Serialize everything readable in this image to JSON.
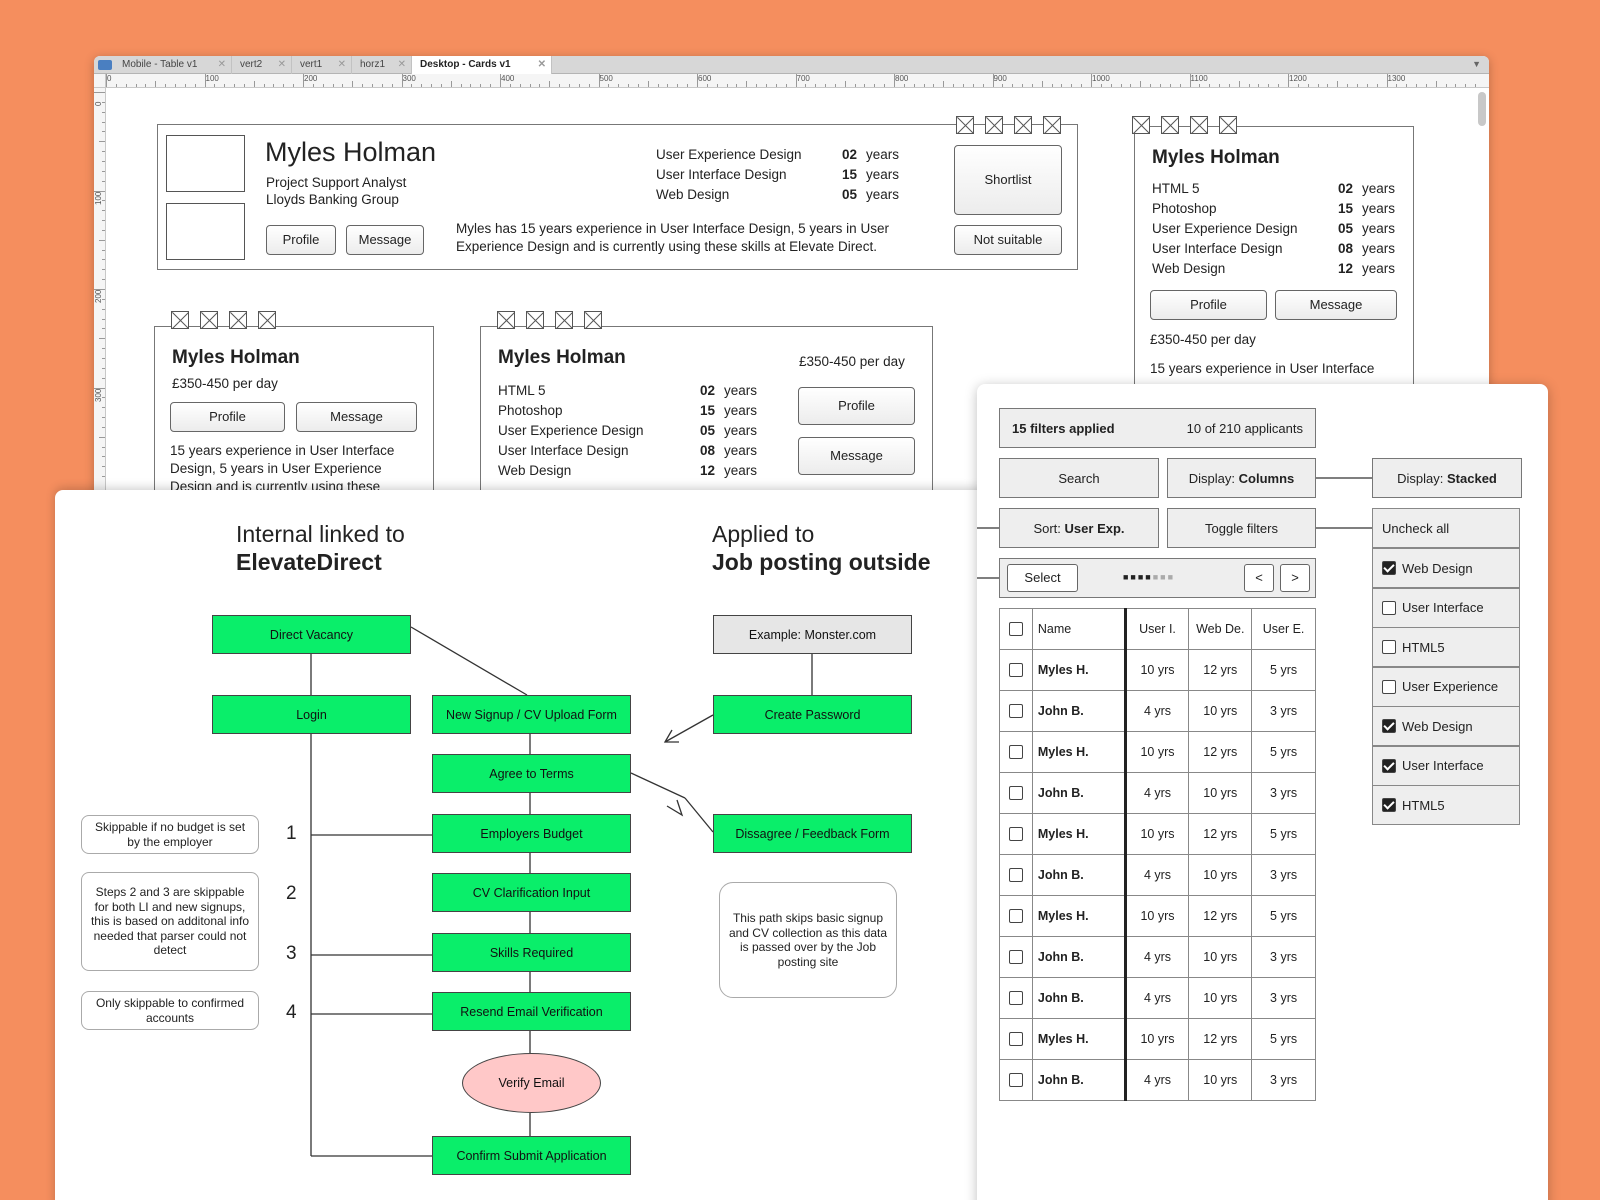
{
  "editor": {
    "tabs": [
      {
        "label": "Mobile - Table v1"
      },
      {
        "label": "vert2"
      },
      {
        "label": "vert1"
      },
      {
        "label": "horz1"
      },
      {
        "label": "Desktop - Cards v1",
        "active": true
      }
    ],
    "ruler_top": [
      "0",
      "100",
      "200",
      "300",
      "400",
      "500",
      "600",
      "700",
      "800",
      "900",
      "1000",
      "1100",
      "1200",
      "1300"
    ],
    "ruler_left": [
      "0",
      "100",
      "200",
      "300"
    ]
  },
  "card_wide": {
    "name": "Myles Holman",
    "role": "Project Support Analyst",
    "company": "Lloyds Banking Group",
    "profile_label": "Profile",
    "message_label": "Message",
    "skills": [
      {
        "skill": "User Experience Design",
        "num": "02",
        "unit": "years"
      },
      {
        "skill": "User Interface Design",
        "num": "15",
        "unit": "years"
      },
      {
        "skill": "Web Design",
        "num": "05",
        "unit": "years"
      }
    ],
    "summary": "Myles has 15 years experience in User Interface Design, 5 years in User Experience Design and is currently using these skills at Elevate Direct.",
    "shortlist_label": "Shortlist",
    "not_suitable_label": "Not suitable"
  },
  "card_right": {
    "name": "Myles Holman",
    "skills": [
      {
        "skill": "HTML 5",
        "num": "02",
        "unit": "years"
      },
      {
        "skill": "Photoshop",
        "num": "15",
        "unit": "years"
      },
      {
        "skill": "User Experience Design",
        "num": "05",
        "unit": "years"
      },
      {
        "skill": "User Interface Design",
        "num": "08",
        "unit": "years"
      },
      {
        "skill": "Web Design",
        "num": "12",
        "unit": "years"
      }
    ],
    "profile_label": "Profile",
    "message_label": "Message",
    "rate": "£350-450 per day",
    "summary": "15 years experience in User Interface"
  },
  "card_small": {
    "name": "Myles Holman",
    "rate": "£350-450 per day",
    "profile_label": "Profile",
    "message_label": "Message",
    "summary": "15 years experience in User Interface Design, 5 years in User Experience Design and is currently using these"
  },
  "card_mid": {
    "name": "Myles Holman",
    "rate": "£350-450 per day",
    "skills": [
      {
        "skill": "HTML 5",
        "num": "02",
        "unit": "years"
      },
      {
        "skill": "Photoshop",
        "num": "15",
        "unit": "years"
      },
      {
        "skill": "User Experience Design",
        "num": "05",
        "unit": "years"
      },
      {
        "skill": "User Interface Design",
        "num": "08",
        "unit": "years"
      },
      {
        "skill": "Web Design",
        "num": "12",
        "unit": "years"
      }
    ],
    "profile_label": "Profile",
    "message_label": "Message"
  },
  "flow": {
    "left_heading_1": "Internal linked to",
    "left_heading_2": "ElevateDirect",
    "right_heading_1": "Applied to",
    "right_heading_2": "Job posting outside",
    "direct_vacancy": "Direct Vacancy",
    "login": "Login",
    "new_signup": "New Signup / CV Upload Form",
    "agree_terms": "Agree to Terms",
    "employers_budget": "Employers Budget",
    "cv_clarification": "CV Clarification Input",
    "skills_required": "Skills Required",
    "resend_email": "Resend Email Verification",
    "verify_email": "Verify Email",
    "confirm_submit": "Confirm Submit Application",
    "example_monster": "Example: Monster.com",
    "create_password": "Create Password",
    "disagree_form": "Dissagree / Feedback Form",
    "note_1": "Skippable if no budget is set by the employer",
    "note_2": "Steps 2 and 3 are skippable for both LI and new signups, this is based on additonal info needed that parser could not detect",
    "note_3": "Only skippable to confirmed accounts",
    "note_right": "This path skips basic signup and CV collection as this data is passed over by the Job posting site",
    "steps": [
      "1",
      "2",
      "3",
      "4"
    ],
    "colors": {
      "green": "#0aee6a",
      "pink": "#ffc8c8",
      "grey": "#e6e6e6"
    }
  },
  "table_view": {
    "filters_applied": "15 filters applied",
    "applicants": "10 of 210 applicants",
    "search_label": "Search",
    "display_prefix": "Display:",
    "display_value": "Columns",
    "sort_prefix": "Sort:",
    "sort_value": "User Exp.",
    "toggle_filters": "Toggle filters",
    "select_label": "Select",
    "prev_label": "<",
    "next_label": ">",
    "columns": [
      "Name",
      "User I.",
      "Web De.",
      "User E."
    ],
    "rows": [
      [
        "Myles H.",
        "10 yrs",
        "12 yrs",
        "5 yrs"
      ],
      [
        "John B.",
        "4 yrs",
        "10 yrs",
        "3 yrs"
      ],
      [
        "Myles H.",
        "10 yrs",
        "12 yrs",
        "5 yrs"
      ],
      [
        "John B.",
        "4 yrs",
        "10 yrs",
        "3 yrs"
      ],
      [
        "Myles H.",
        "10 yrs",
        "12 yrs",
        "5 yrs"
      ],
      [
        "John B.",
        "4 yrs",
        "10 yrs",
        "3 yrs"
      ],
      [
        "Myles H.",
        "10 yrs",
        "12 yrs",
        "5 yrs"
      ],
      [
        "John B.",
        "4 yrs",
        "10 yrs",
        "3 yrs"
      ],
      [
        "John B.",
        "4 yrs",
        "10 yrs",
        "3 yrs"
      ],
      [
        "Myles H.",
        "10 yrs",
        "12 yrs",
        "5 yrs"
      ],
      [
        "John B.",
        "4 yrs",
        "10 yrs",
        "3 yrs"
      ]
    ],
    "stacked_prefix": "Display:",
    "stacked_value": "Stacked",
    "uncheck_all": "Uncheck all",
    "filters": [
      {
        "label": "Web Design",
        "checked": true
      },
      {
        "label": "User Interface",
        "checked": false
      },
      {
        "label": "HTML5",
        "checked": false
      },
      {
        "label": "User Experience",
        "checked": false
      },
      {
        "label": "Web Design",
        "checked": true
      },
      {
        "label": "User Interface",
        "checked": true
      },
      {
        "label": "HTML5",
        "checked": true
      }
    ]
  }
}
